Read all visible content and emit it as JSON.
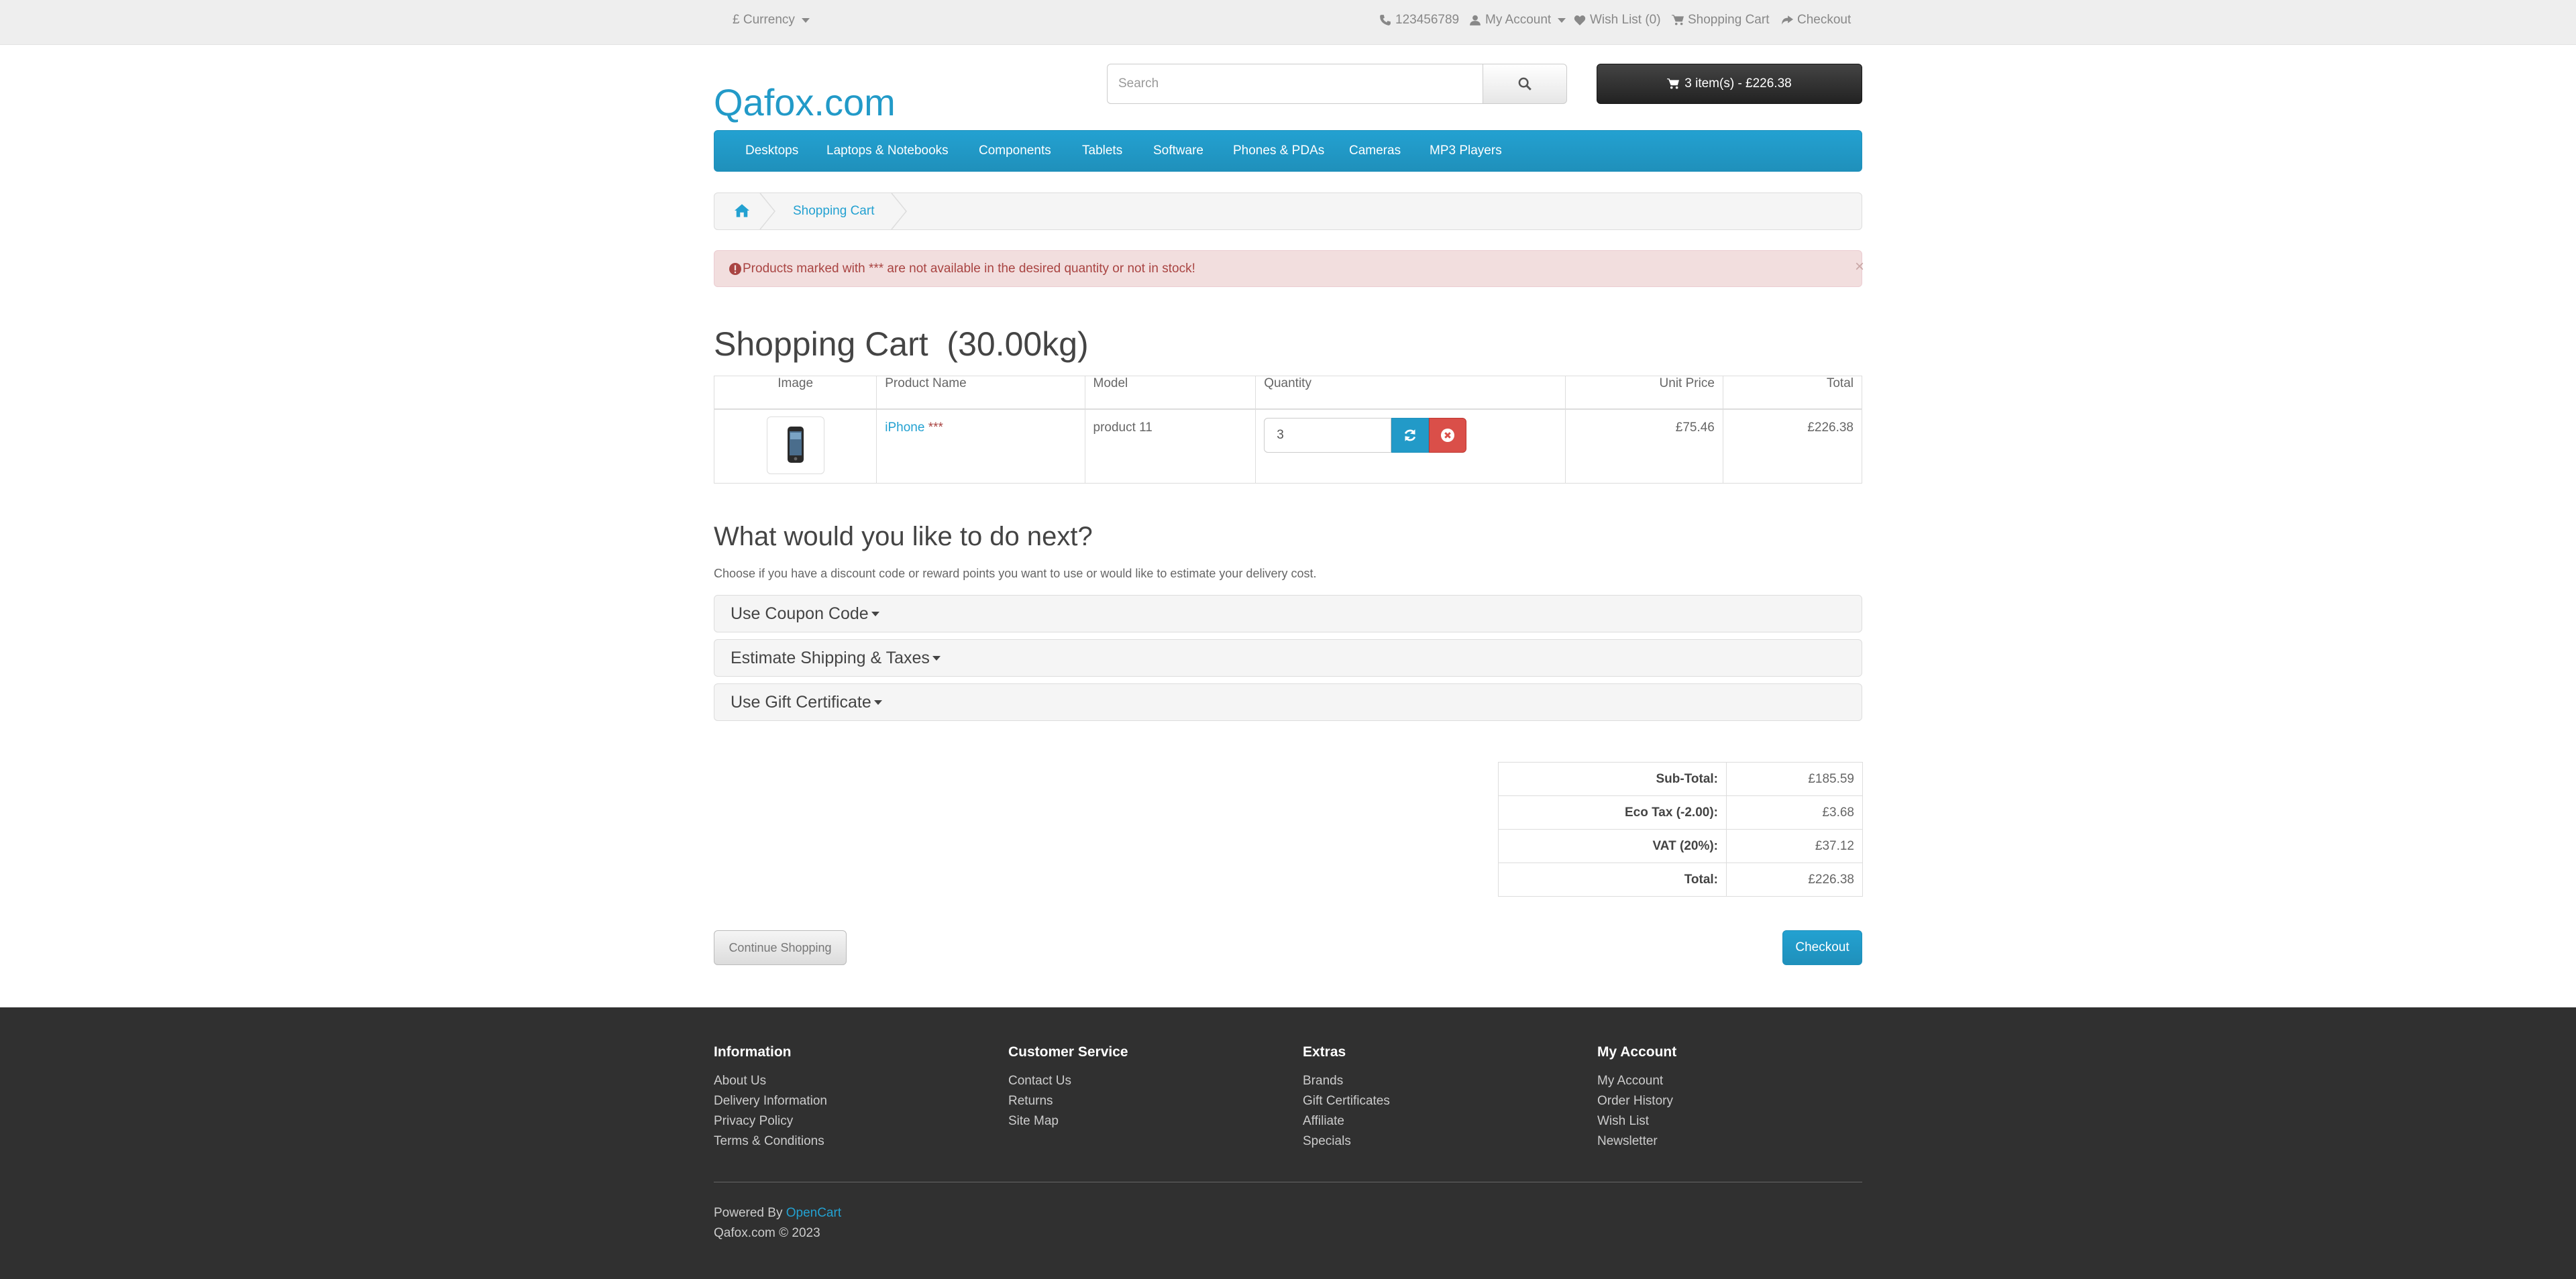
{
  "topbar": {
    "currency": "£ Currency",
    "phone": "123456789",
    "my_account": "My Account",
    "wishlist": "Wish List (0)",
    "shopping_cart": "Shopping Cart",
    "checkout": "Checkout"
  },
  "header": {
    "logo": "Qafox.com",
    "search_placeholder": "Search",
    "cart_summary": "3 item(s) - £226.38"
  },
  "menu": [
    "Desktops",
    "Laptops & Notebooks",
    "Components",
    "Tablets",
    "Software",
    "Phones & PDAs",
    "Cameras",
    "MP3 Players"
  ],
  "breadcrumb": {
    "current": "Shopping Cart"
  },
  "alert": {
    "message": "Products marked with *** are not available in the desired quantity or not in stock!",
    "close": "×"
  },
  "page_title": "Shopping Cart  (30.00kg)",
  "cart_table": {
    "headers": [
      "Image",
      "Product Name",
      "Model",
      "Quantity",
      "Unit Price",
      "Total"
    ],
    "rows": [
      {
        "name": "iPhone",
        "stock_flag": "***",
        "model": "product 11",
        "quantity": "3",
        "unit_price": "£75.46",
        "total": "£226.38"
      }
    ]
  },
  "next": {
    "title": "What would you like to do next?",
    "description": "Choose if you have a discount code or reward points you want to use or would like to estimate your delivery cost.",
    "panels": [
      "Use Coupon Code",
      "Estimate Shipping & Taxes",
      "Use Gift Certificate"
    ]
  },
  "totals": [
    {
      "label": "Sub-Total:",
      "value": "£185.59"
    },
    {
      "label": "Eco Tax (-2.00):",
      "value": "£3.68"
    },
    {
      "label": "VAT (20%):",
      "value": "£37.12"
    },
    {
      "label": "Total:",
      "value": "£226.38"
    }
  ],
  "buttons": {
    "continue": "Continue Shopping",
    "checkout": "Checkout"
  },
  "footer": {
    "columns": [
      {
        "title": "Information",
        "links": [
          "About Us",
          "Delivery Information",
          "Privacy Policy",
          "Terms & Conditions"
        ]
      },
      {
        "title": "Customer Service",
        "links": [
          "Contact Us",
          "Returns",
          "Site Map"
        ]
      },
      {
        "title": "Extras",
        "links": [
          "Brands",
          "Gift Certificates",
          "Affiliate",
          "Specials"
        ]
      },
      {
        "title": "My Account",
        "links": [
          "My Account",
          "Order History",
          "Wish List",
          "Newsletter"
        ]
      }
    ],
    "powered_prefix": "Powered By ",
    "powered_link": "OpenCart",
    "copyright": "Qafox.com © 2023"
  },
  "colors": {
    "accent": "#229ac8",
    "danger": "#da4f49",
    "footer_bg": "#303030",
    "alert_bg": "#f2dede"
  },
  "icons": [
    "phone-icon",
    "user-icon",
    "heart-icon",
    "cart-icon",
    "share-icon",
    "search-icon",
    "home-icon",
    "exclamation-circle-icon",
    "refresh-icon",
    "remove-icon"
  ]
}
